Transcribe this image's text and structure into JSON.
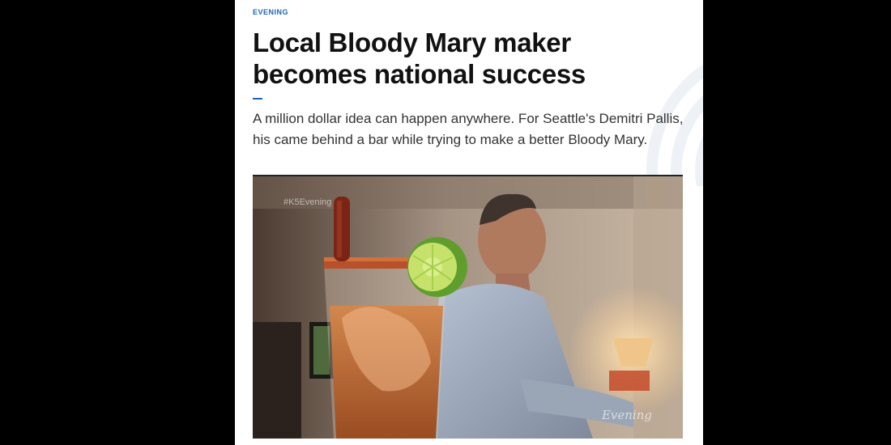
{
  "article": {
    "section": "EVENING",
    "headline": "Local Bloody Mary maker becomes national success",
    "summary": "A million dollar idea can happen anywhere. For Seattle's Demitri Pallis, his came behind a bar while trying to make a better Bloody Mary."
  },
  "video": {
    "hashtag": "#K5Evening",
    "watermark": "Evening"
  },
  "colors": {
    "accent": "#1d63b7",
    "page_bg": "#000000",
    "content_bg": "#ffffff"
  }
}
